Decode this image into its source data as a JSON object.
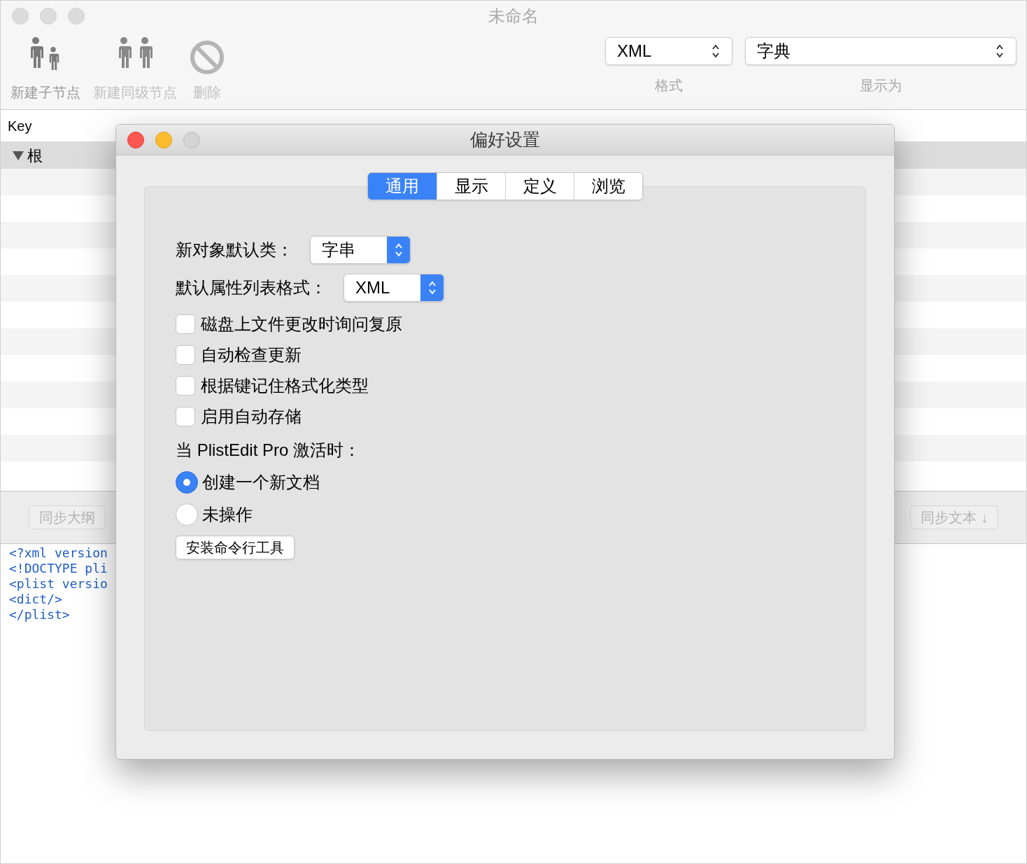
{
  "window": {
    "title": "未命名"
  },
  "toolbar": {
    "items": [
      {
        "kind": "child",
        "label": "新建子节点",
        "disabled": false
      },
      {
        "kind": "sibling",
        "label": "新建同级节点",
        "disabled": true
      },
      {
        "kind": "delete",
        "label": "删除",
        "disabled": true
      }
    ],
    "format": {
      "value": "XML",
      "label": "格式"
    },
    "display": {
      "value": "字典",
      "label": "显示为"
    }
  },
  "outline": {
    "columns": [
      "Key"
    ],
    "root": {
      "label": "根",
      "expanded": true,
      "selected": true
    }
  },
  "sync_buttons": [
    "同步大纲",
    "同步文本 ↓"
  ],
  "code_lines": [
    "<?xml version",
    "<!DOCTYPE pli",
    "<plist versio",
    "<dict/>",
    "</plist>"
  ],
  "dialog": {
    "title": "偏好设置",
    "tabs": [
      {
        "label": "通用",
        "selected": true
      },
      {
        "label": "显示",
        "selected": false
      },
      {
        "label": "定义",
        "selected": false
      },
      {
        "label": "浏览",
        "selected": false
      }
    ],
    "popups": [
      {
        "label": "新对象默认类：",
        "value": "字串"
      },
      {
        "label": "默认属性列表格式：",
        "value": "XML"
      }
    ],
    "checkboxes": [
      {
        "label": "磁盘上文件更改时询问复原",
        "checked": false
      },
      {
        "label": "自动检查更新",
        "checked": false
      },
      {
        "label": "根据键记住格式化类型",
        "checked": false
      },
      {
        "label": "启用自动存储",
        "checked": false
      }
    ],
    "activation_label": "当 PlistEdit Pro 激活时：",
    "radios": [
      {
        "label": "创建一个新文档",
        "selected": true
      },
      {
        "label": "未操作",
        "selected": false
      }
    ],
    "button": "安装命令行工具"
  }
}
